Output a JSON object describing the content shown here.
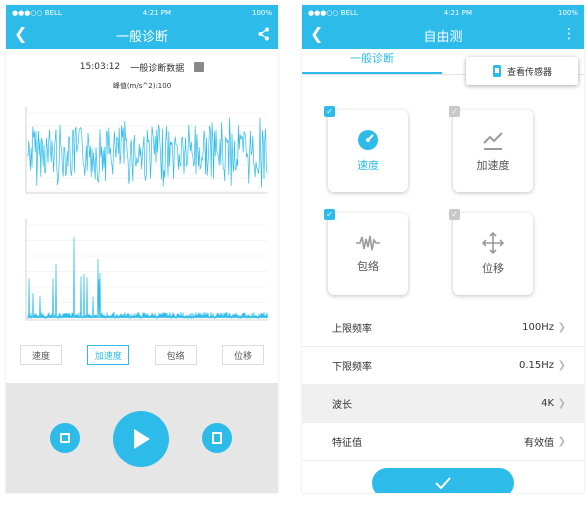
{
  "left": {
    "status": {
      "carrier": "●●●○○ BELL",
      "time": "4:21 PM",
      "battery": "100%"
    },
    "title": "一般诊断",
    "timestamp": "15:03:12",
    "data_label": "一般诊断数据",
    "peak_label": "峰值(m/s^2):100",
    "tabs": [
      "速度",
      "加速度",
      "包络",
      "位移"
    ],
    "colors": {
      "accent": "#2dbcea",
      "player_bg": "#e6e6e6"
    }
  },
  "right": {
    "status": {
      "carrier": "●●●○○ BELL",
      "time": "4:21 PM",
      "battery": "100%"
    },
    "title": "自由测",
    "tab": "一般诊断",
    "popup_label": "查看传感器",
    "tiles": [
      {
        "label": "速度",
        "checked": true,
        "icon": "speedometer-icon"
      },
      {
        "label": "加速度",
        "checked": false,
        "icon": "acceleration-icon"
      },
      {
        "label": "包络",
        "checked": true,
        "icon": "envelope-icon"
      },
      {
        "label": "位移",
        "checked": false,
        "icon": "move-icon"
      }
    ],
    "settings": [
      {
        "label": "上限频率",
        "value": "100Hz"
      },
      {
        "label": "下限频率",
        "value": "0.15Hz"
      },
      {
        "label": "波长",
        "value": "4K"
      },
      {
        "label": "特征值",
        "value": "有效值"
      }
    ]
  }
}
